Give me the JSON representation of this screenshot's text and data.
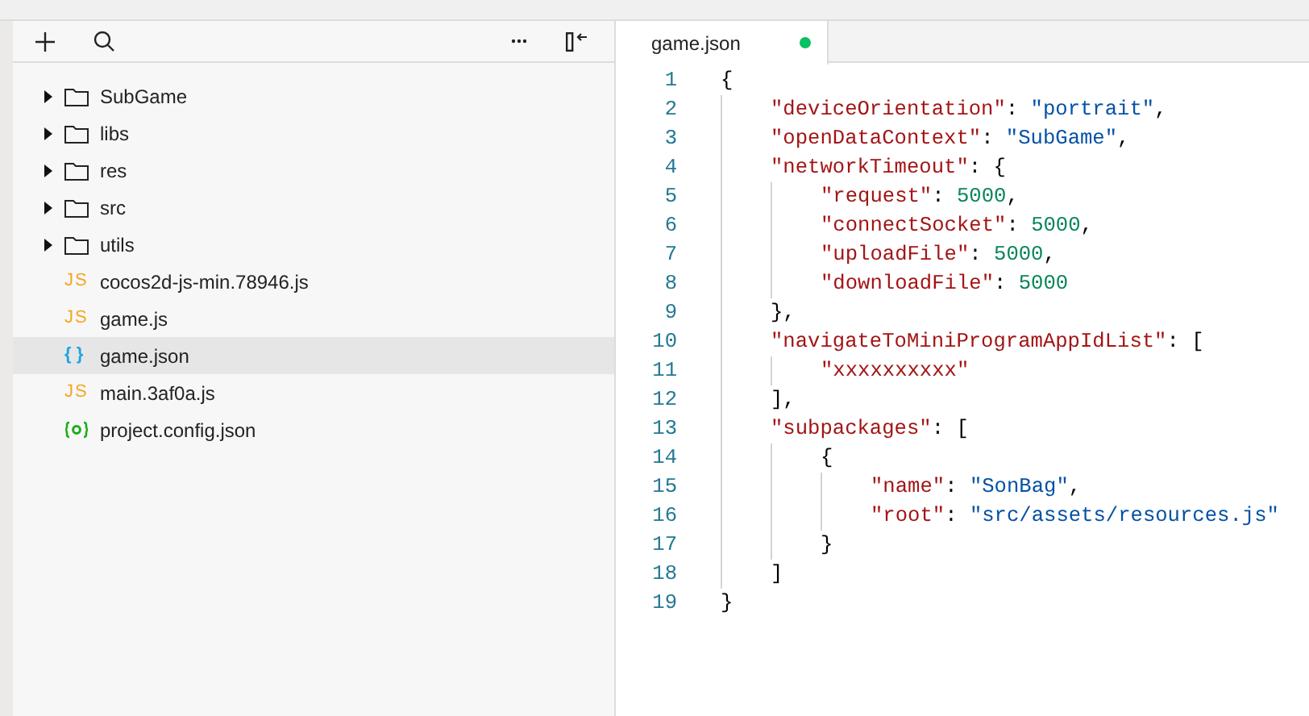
{
  "explorer": {
    "items": [
      {
        "name": "SubGame",
        "kind": "folder",
        "expanded": false,
        "selected": false
      },
      {
        "name": "libs",
        "kind": "folder",
        "expanded": false,
        "selected": false
      },
      {
        "name": "res",
        "kind": "folder",
        "expanded": false,
        "selected": false
      },
      {
        "name": "src",
        "kind": "folder",
        "expanded": false,
        "selected": false
      },
      {
        "name": "utils",
        "kind": "folder",
        "expanded": false,
        "selected": false
      },
      {
        "name": "cocos2d-js-min.78946.js",
        "kind": "js",
        "icon": "JS",
        "selected": false
      },
      {
        "name": "game.js",
        "kind": "js",
        "icon": "JS",
        "selected": false
      },
      {
        "name": "game.json",
        "kind": "json",
        "icon": "{ }",
        "selected": true
      },
      {
        "name": "main.3af0a.js",
        "kind": "js",
        "icon": "JS",
        "selected": false
      },
      {
        "name": "project.config.json",
        "kind": "config",
        "selected": false
      }
    ]
  },
  "editor": {
    "tabs": [
      {
        "label": "game.json",
        "selected": true,
        "modified": true
      }
    ],
    "lines": [
      {
        "number": "1",
        "tokens": [
          {
            "kind": "punct",
            "text": "{"
          }
        ],
        "children": [
          {
            "number": "2",
            "tokens": [
              {
                "kind": "key",
                "text": "\"deviceOrientation\""
              },
              {
                "kind": "punct",
                "text": ": "
              },
              {
                "kind": "string",
                "text": "\"portrait\""
              },
              {
                "kind": "punct",
                "text": ","
              }
            ]
          },
          {
            "number": "3",
            "tokens": [
              {
                "kind": "key",
                "text": "\"openDataContext\""
              },
              {
                "kind": "punct",
                "text": ": "
              },
              {
                "kind": "string",
                "text": "\"SubGame\""
              },
              {
                "kind": "punct",
                "text": ","
              }
            ]
          },
          {
            "number": "4",
            "tokens": [
              {
                "kind": "key",
                "text": "\"networkTimeout\""
              },
              {
                "kind": "punct",
                "text": ": {"
              }
            ],
            "children": [
              {
                "number": "5",
                "tokens": [
                  {
                    "kind": "key",
                    "text": "\"request\""
                  },
                  {
                    "kind": "punct",
                    "text": ": "
                  },
                  {
                    "kind": "number",
                    "text": "5000"
                  },
                  {
                    "kind": "punct",
                    "text": ","
                  }
                ]
              },
              {
                "number": "6",
                "tokens": [
                  {
                    "kind": "key",
                    "text": "\"connectSocket\""
                  },
                  {
                    "kind": "punct",
                    "text": ": "
                  },
                  {
                    "kind": "number",
                    "text": "5000"
                  },
                  {
                    "kind": "punct",
                    "text": ","
                  }
                ]
              },
              {
                "number": "7",
                "tokens": [
                  {
                    "kind": "key",
                    "text": "\"uploadFile\""
                  },
                  {
                    "kind": "punct",
                    "text": ": "
                  },
                  {
                    "kind": "number",
                    "text": "5000"
                  },
                  {
                    "kind": "punct",
                    "text": ","
                  }
                ]
              },
              {
                "number": "8",
                "tokens": [
                  {
                    "kind": "key",
                    "text": "\"downloadFile\""
                  },
                  {
                    "kind": "punct",
                    "text": ": "
                  },
                  {
                    "kind": "number",
                    "text": "5000"
                  }
                ]
              }
            ]
          },
          {
            "number": "9",
            "tokens": [
              {
                "kind": "punct",
                "text": "},"
              }
            ]
          },
          {
            "number": "10",
            "tokens": [
              {
                "kind": "key",
                "text": "\"navigateToMiniProgramAppIdList\""
              },
              {
                "kind": "punct",
                "text": ": ["
              }
            ],
            "children": [
              {
                "number": "11",
                "tokens": [
                  {
                    "kind": "key",
                    "text": "\"xxxxxxxxxx\""
                  }
                ]
              }
            ]
          },
          {
            "number": "12",
            "tokens": [
              {
                "kind": "punct",
                "text": "],"
              }
            ]
          },
          {
            "number": "13",
            "tokens": [
              {
                "kind": "key",
                "text": "\"subpackages\""
              },
              {
                "kind": "punct",
                "text": ": ["
              }
            ],
            "children": [
              {
                "number": "14",
                "tokens": [
                  {
                    "kind": "punct",
                    "text": "{"
                  }
                ],
                "children": [
                  {
                    "number": "15",
                    "tokens": [
                      {
                        "kind": "key",
                        "text": "\"name\""
                      },
                      {
                        "kind": "punct",
                        "text": ": "
                      },
                      {
                        "kind": "string",
                        "text": "\"SonBag\""
                      },
                      {
                        "kind": "punct",
                        "text": ","
                      }
                    ]
                  },
                  {
                    "number": "16",
                    "tokens": [
                      {
                        "kind": "key",
                        "text": "\"root\""
                      },
                      {
                        "kind": "punct",
                        "text": ": "
                      },
                      {
                        "kind": "string",
                        "text": "\"src/assets/resources.js\""
                      }
                    ]
                  }
                ]
              },
              {
                "number": "17",
                "tokens": [
                  {
                    "kind": "punct",
                    "text": "}"
                  }
                ]
              }
            ]
          },
          {
            "number": "18",
            "tokens": [
              {
                "kind": "punct",
                "text": "]"
              }
            ]
          }
        ]
      },
      {
        "number": "19",
        "tokens": [
          {
            "kind": "punct",
            "text": "}"
          }
        ]
      }
    ]
  }
}
